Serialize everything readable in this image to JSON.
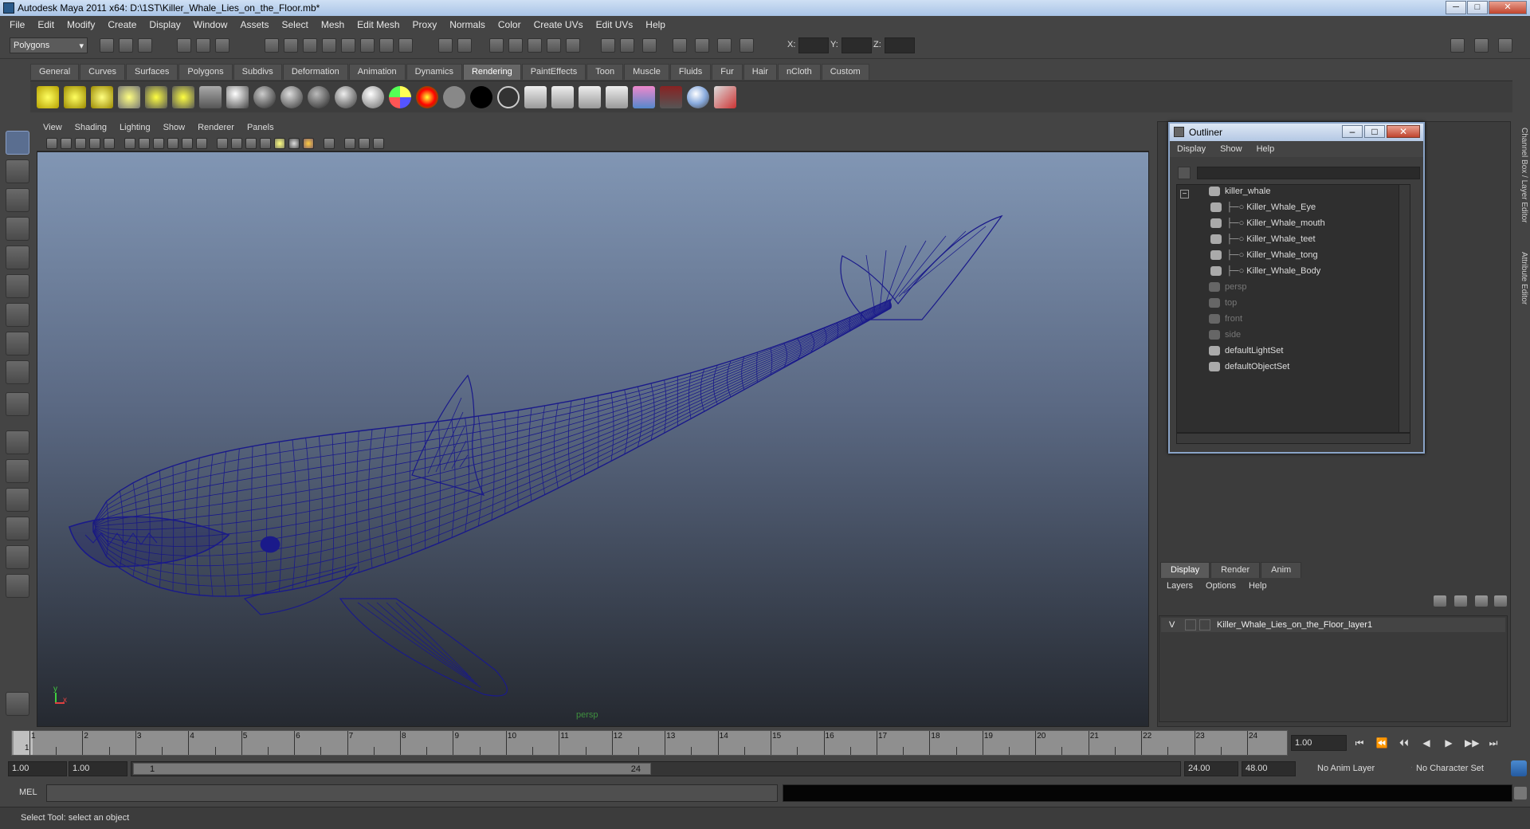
{
  "window": {
    "title": "Autodesk Maya 2011 x64: D:\\1ST\\Killer_Whale_Lies_on_the_Floor.mb*",
    "min_label": "─",
    "max_label": "□",
    "close_label": "✕"
  },
  "menubar": [
    "File",
    "Edit",
    "Modify",
    "Create",
    "Display",
    "Window",
    "Assets",
    "Select",
    "Mesh",
    "Edit Mesh",
    "Proxy",
    "Normals",
    "Color",
    "Create UVs",
    "Edit UVs",
    "Help"
  ],
  "statusline": {
    "mode": "Polygons",
    "x_label": "X:",
    "y_label": "Y:",
    "z_label": "Z:"
  },
  "shelf_tabs": [
    {
      "label": "General",
      "active": false
    },
    {
      "label": "Curves",
      "active": false
    },
    {
      "label": "Surfaces",
      "active": false
    },
    {
      "label": "Polygons",
      "active": false
    },
    {
      "label": "Subdivs",
      "active": false
    },
    {
      "label": "Deformation",
      "active": false
    },
    {
      "label": "Animation",
      "active": false
    },
    {
      "label": "Dynamics",
      "active": false
    },
    {
      "label": "Rendering",
      "active": true
    },
    {
      "label": "PaintEffects",
      "active": false
    },
    {
      "label": "Toon",
      "active": false
    },
    {
      "label": "Muscle",
      "active": false
    },
    {
      "label": "Fluids",
      "active": false
    },
    {
      "label": "Fur",
      "active": false
    },
    {
      "label": "Hair",
      "active": false
    },
    {
      "label": "nCloth",
      "active": false
    },
    {
      "label": "Custom",
      "active": false
    }
  ],
  "viewport": {
    "menu": [
      "View",
      "Shading",
      "Lighting",
      "Show",
      "Renderer",
      "Panels"
    ],
    "camera": "persp",
    "axis_y": "y",
    "axis_x": "x",
    "colors": {
      "wire": "#1a1a8a"
    }
  },
  "outliner": {
    "title": "Outliner",
    "menu": [
      "Display",
      "Show",
      "Help"
    ],
    "items": [
      {
        "label": "killer_whale",
        "dim": false,
        "indent": 0,
        "icon": "transform-icon"
      },
      {
        "label": "Killer_Whale_Eye",
        "dim": false,
        "indent": 1,
        "icon": "mesh-icon"
      },
      {
        "label": "Killer_Whale_mouth",
        "dim": false,
        "indent": 1,
        "icon": "mesh-icon"
      },
      {
        "label": "Killer_Whale_teet",
        "dim": false,
        "indent": 1,
        "icon": "mesh-icon"
      },
      {
        "label": "Killer_Whale_tong",
        "dim": false,
        "indent": 1,
        "icon": "mesh-icon"
      },
      {
        "label": "Killer_Whale_Body",
        "dim": false,
        "indent": 1,
        "icon": "mesh-icon"
      },
      {
        "label": "persp",
        "dim": true,
        "indent": 0,
        "icon": "camera-icon"
      },
      {
        "label": "top",
        "dim": true,
        "indent": 0,
        "icon": "camera-icon"
      },
      {
        "label": "front",
        "dim": true,
        "indent": 0,
        "icon": "camera-icon"
      },
      {
        "label": "side",
        "dim": true,
        "indent": 0,
        "icon": "camera-icon"
      },
      {
        "label": "defaultLightSet",
        "dim": false,
        "indent": 0,
        "icon": "set-icon"
      },
      {
        "label": "defaultObjectSet",
        "dim": false,
        "indent": 0,
        "icon": "set-icon"
      }
    ]
  },
  "side_tabs": [
    "Channel Box / Layer Editor",
    "Attribute Editor"
  ],
  "layer_editor": {
    "tabs": [
      {
        "label": "Display",
        "active": true
      },
      {
        "label": "Render",
        "active": false
      },
      {
        "label": "Anim",
        "active": false
      }
    ],
    "menu": [
      "Layers",
      "Options",
      "Help"
    ],
    "layer": {
      "visible": "V",
      "name": "Killer_Whale_Lies_on_the_Floor_layer1"
    }
  },
  "timeline": {
    "start": 1,
    "end": 24,
    "ticks": [
      "1",
      "2",
      "3",
      "4",
      "5",
      "6",
      "7",
      "8",
      "9",
      "10",
      "11",
      "12",
      "13",
      "14",
      "15",
      "16",
      "17",
      "18",
      "19",
      "20",
      "21",
      "22",
      "23",
      "24"
    ],
    "current_frame": "1",
    "current_time_field": "1.00",
    "playback": [
      "⏮",
      "⏪",
      "⏴⏴",
      "◀",
      "▶",
      "▶▶",
      "⏭"
    ]
  },
  "range": {
    "start_time": "1.00",
    "playback_start": "1.00",
    "slider_start": "1",
    "slider_end": "24",
    "playback_end": "24.00",
    "end_time": "48.00",
    "anim_layer": "No Anim Layer",
    "character_set": "No Character Set"
  },
  "command": {
    "label": "MEL"
  },
  "help_line": "Select Tool: select an object"
}
